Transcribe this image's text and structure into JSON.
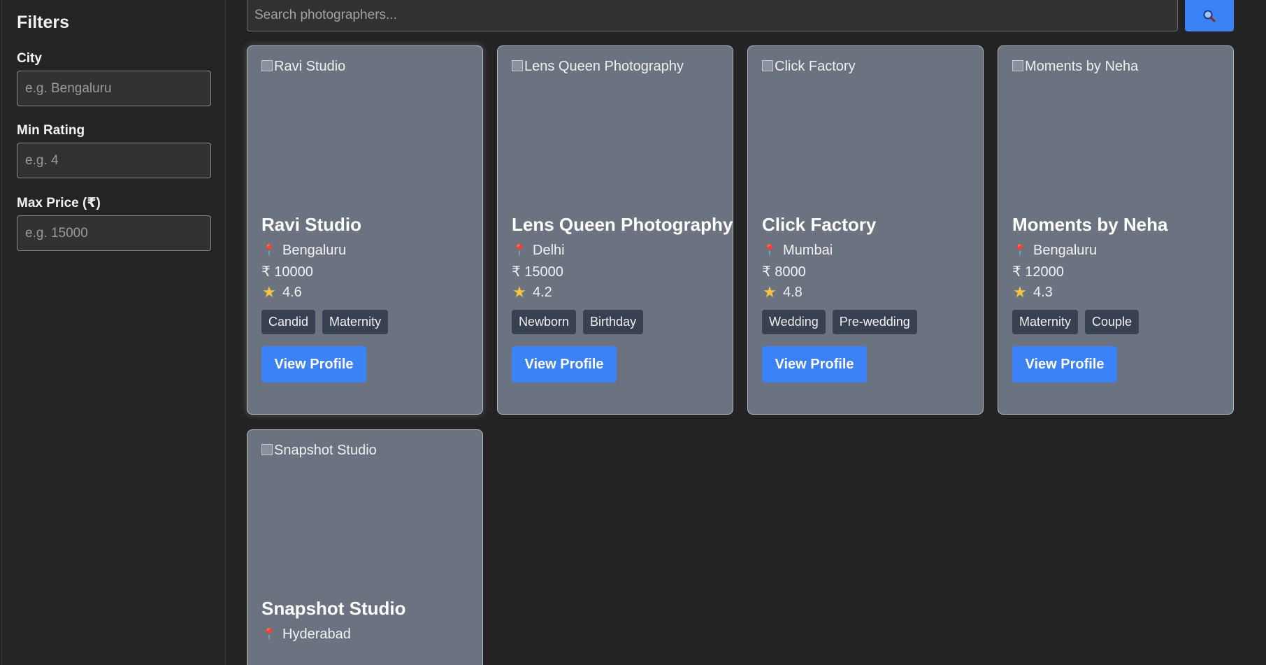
{
  "filters": {
    "title": "Filters",
    "city": {
      "label": "City",
      "placeholder": "e.g. Bengaluru"
    },
    "min_rating": {
      "label": "Min Rating",
      "placeholder": "e.g. 4"
    },
    "max_price": {
      "label": "Max Price (₹)",
      "placeholder": "e.g. 15000"
    }
  },
  "search": {
    "placeholder": "Search photographers...",
    "button_icon": "search-icon"
  },
  "icons": {
    "location": "pin-icon",
    "rating": "star-icon"
  },
  "colors": {
    "accent": "#3b82f6",
    "card_bg": "#6b7280",
    "tag_bg": "#374151",
    "page_bg": "#232323"
  },
  "cards": [
    {
      "image_alt": "Ravi Studio",
      "name": "Ravi Studio",
      "city": "Bengaluru",
      "price": "₹ 10000",
      "rating": "4.6",
      "tags": [
        "Candid",
        "Maternity"
      ],
      "button": "View Profile"
    },
    {
      "image_alt": "Lens Queen Photography",
      "name": "Lens Queen Photography",
      "city": "Delhi",
      "price": "₹ 15000",
      "rating": "4.2",
      "tags": [
        "Newborn",
        "Birthday"
      ],
      "button": "View Profile"
    },
    {
      "image_alt": "Click Factory",
      "name": "Click Factory",
      "city": "Mumbai",
      "price": "₹ 8000",
      "rating": "4.8",
      "tags": [
        "Wedding",
        "Pre-wedding"
      ],
      "button": "View Profile"
    },
    {
      "image_alt": "Moments by Neha",
      "name": "Moments by Neha",
      "city": "Bengaluru",
      "price": "₹ 12000",
      "rating": "4.3",
      "tags": [
        "Maternity",
        "Couple"
      ],
      "button": "View Profile"
    },
    {
      "image_alt": "Snapshot Studio",
      "name": "Snapshot Studio",
      "city": "Hyderabad"
    }
  ]
}
